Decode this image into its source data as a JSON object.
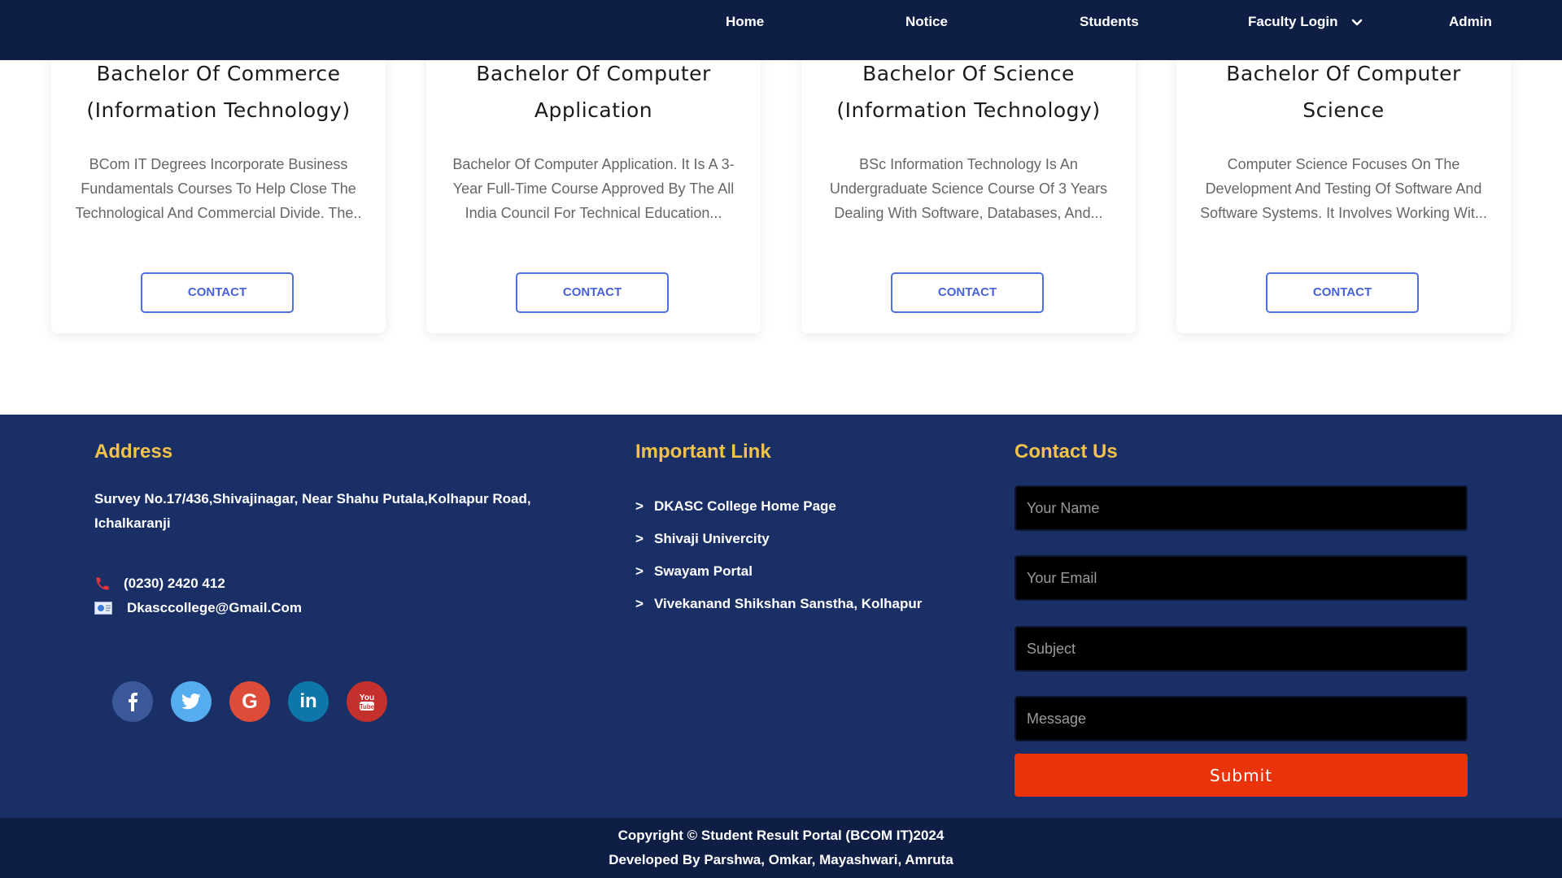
{
  "nav": {
    "items": [
      {
        "label": "Home"
      },
      {
        "label": "Notice"
      },
      {
        "label": "Students"
      },
      {
        "label": "Faculty Login",
        "has_dropdown": true
      },
      {
        "label": "Admin"
      }
    ]
  },
  "courses": [
    {
      "title_line1": "Bachelor Of Commerce",
      "title_line2": "(Information Technology)",
      "desc": [
        "BCom IT Degrees Incorporate Business",
        "Fundamentals Courses To Help Close The",
        "Technological And Commercial Divide. The.."
      ],
      "button": "CONTACT"
    },
    {
      "title_line1": "Bachelor Of Computer",
      "title_line2": "Application",
      "desc": [
        "Bachelor Of Computer Application. It Is A 3-",
        "Year Full-Time Course Approved By The All",
        "India Council For Technical Education..."
      ],
      "button": "CONTACT"
    },
    {
      "title_line1": "Bachelor Of Science",
      "title_line2": "(Information Technology)",
      "desc": [
        "BSc Information Technology Is An",
        "Undergraduate Science Course Of 3 Years",
        "Dealing With Software, Databases, And..."
      ],
      "button": "CONTACT"
    },
    {
      "title_line1": "Bachelor Of Computer",
      "title_line2": "Science",
      "desc": [
        "Computer Science Focuses On The",
        "Development And Testing Of Software And",
        "Software Systems. It Involves Working Wit..."
      ],
      "button": "CONTACT"
    }
  ],
  "footer": {
    "address": {
      "heading": "Address",
      "line1": "Survey No.17/436,Shivajinagar, Near Shahu Putala,Kolhapur Road,",
      "line2": "Ichalkaranji",
      "phone": "(0230) 2420 412",
      "email": "Dkasccollege@Gmail.Com"
    },
    "socials": [
      "facebook-icon",
      "twitter-icon",
      "google-icon",
      "linkedin-icon",
      "youtube-icon"
    ],
    "links": {
      "heading": "Important Link",
      "items": [
        {
          "label": "DKASC College Home Page"
        },
        {
          "label": "Shivaji Univercity"
        },
        {
          "label": "Swayam Portal"
        },
        {
          "label": "Vivekanand Shikshan Sanstha, Kolhapur"
        }
      ]
    },
    "contact": {
      "heading": "Contact Us",
      "name_placeholder": "Your Name",
      "email_placeholder": "Your Email",
      "subject_placeholder": "Subject",
      "message_placeholder": "Message",
      "submit_label": "Submit"
    },
    "copyright_line1": "Copyright © Student Result Portal (BCOM IT)2024",
    "copyright_line2": "Developed By Parshwa, Omkar, Mayashwari, Amruta"
  },
  "colors": {
    "nav_bg": "#0f1e45",
    "footer_bg": "#1a2f66",
    "heading_accent": "#f2c24b",
    "contact_button_border": "#4f6fe3",
    "submit_bg": "#e8330b"
  }
}
